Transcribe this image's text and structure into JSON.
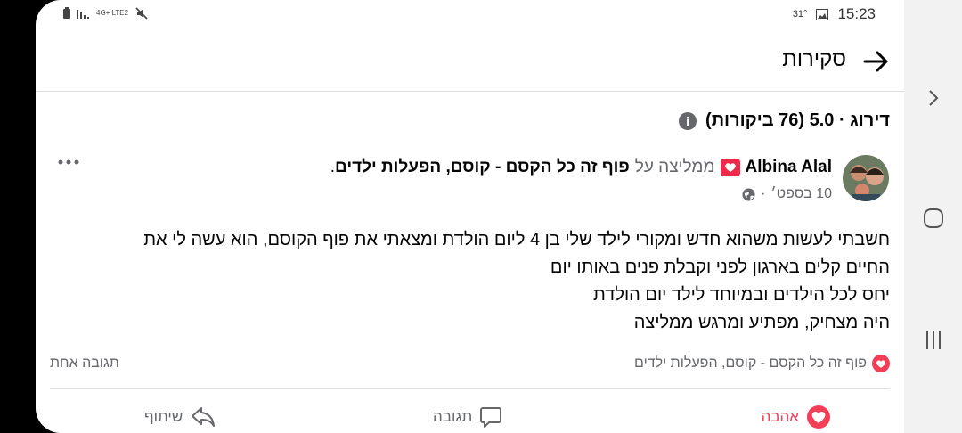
{
  "status_bar": {
    "network": "4G+ LTE2",
    "temperature": "31°",
    "time": "15:23"
  },
  "header": {
    "title": "סקירות"
  },
  "rating": {
    "text": "דירוג · 5.0 (76 ביקורות)"
  },
  "post": {
    "author": "Albina Alal",
    "recommends": "ממליצה על",
    "page_name": "פוף זה כל הקסם - קוסם, הפעלות ילדים",
    "period": ".",
    "date": "10 בספט׳",
    "date_sep": "·",
    "body_lines": [
      "חשבתי לעשות משהוא חדש ומקורי לילד שלי בן 4 ליום הולדת ומצאתי את פוף הקוסם, הוא עשה לי את",
      "החיים קלים בארגון לפני וקבלת פנים באותו יום",
      "יחס לכל הילדים ובמיוחד לילד יום הולדת",
      "היה מצחיק, מפתיע ומרגש ממליצה"
    ]
  },
  "reactions": {
    "reactor": "פוף זה כל הקסם - קוסם, הפעלות ילדים",
    "comments_count": "תגובה אחת"
  },
  "actions": {
    "love": "אהבה",
    "comment": "תגובה",
    "share": "שיתוף"
  },
  "colors": {
    "love": "#f33e58",
    "badge": "#f02849",
    "secondary_text": "#65676b"
  }
}
